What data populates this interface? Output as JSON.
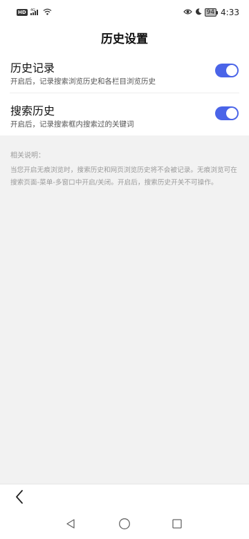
{
  "status_bar": {
    "hd": "HD",
    "network": "4G",
    "battery": "94",
    "time": "4:33"
  },
  "header": {
    "title": "历史设置"
  },
  "settings": [
    {
      "title": "历史记录",
      "description": "开启后，记录搜索浏览历史和各栏目浏览历史",
      "enabled": true
    },
    {
      "title": "搜索历史",
      "description": "开启后，记录搜索框内搜索过的关键词",
      "enabled": true
    }
  ],
  "note": {
    "label": "相关说明：",
    "text": "当您开启无痕浏览时，搜索历史和网页浏览历史将不会被记录。无痕浏览可在搜索页面-菜单-多窗口中开启/关闭。开启后，搜索历史开关不可操作。"
  },
  "colors": {
    "toggle_on": "#4a64e8",
    "background": "#f2f2f2"
  },
  "icons": {
    "back": "chevron-left-icon",
    "nav_back": "triangle-back-icon",
    "nav_home": "circle-home-icon",
    "nav_recent": "square-recent-icon"
  }
}
